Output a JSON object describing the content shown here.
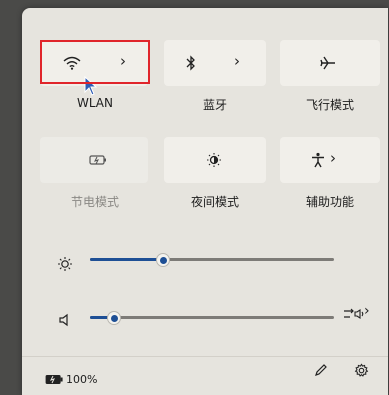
{
  "colors": {
    "accent": "#1e4f95",
    "panel_bg": "#e6e4de",
    "tile_bg": "#f1efea",
    "highlight": "#e0252b"
  },
  "quick_actions": [
    {
      "label": "WLAN",
      "icon": "wifi-icon",
      "has_chevron": true,
      "dim": false
    },
    {
      "label": "蓝牙",
      "icon": "bluetooth-icon",
      "has_chevron": true,
      "dim": false
    },
    {
      "label": "飞行模式",
      "icon": "airplane-icon",
      "has_chevron": false,
      "dim": false
    },
    {
      "label": "节电模式",
      "icon": "battery-saver-icon",
      "has_chevron": false,
      "dim": true
    },
    {
      "label": "夜间模式",
      "icon": "night-light-icon",
      "has_chevron": false,
      "dim": false
    },
    {
      "label": "辅助功能",
      "icon": "accessibility-icon",
      "has_chevron": true,
      "dim": false
    }
  ],
  "brightness": {
    "icon": "brightness-icon",
    "level": 0.3
  },
  "volume": {
    "icon": "speaker-icon",
    "level": 0.1,
    "output_icon": "audio-output-icon"
  },
  "footer": {
    "battery_icon": "battery-icon",
    "battery_text": "100%",
    "edit_icon": "pencil-icon",
    "settings_icon": "gear-icon"
  }
}
